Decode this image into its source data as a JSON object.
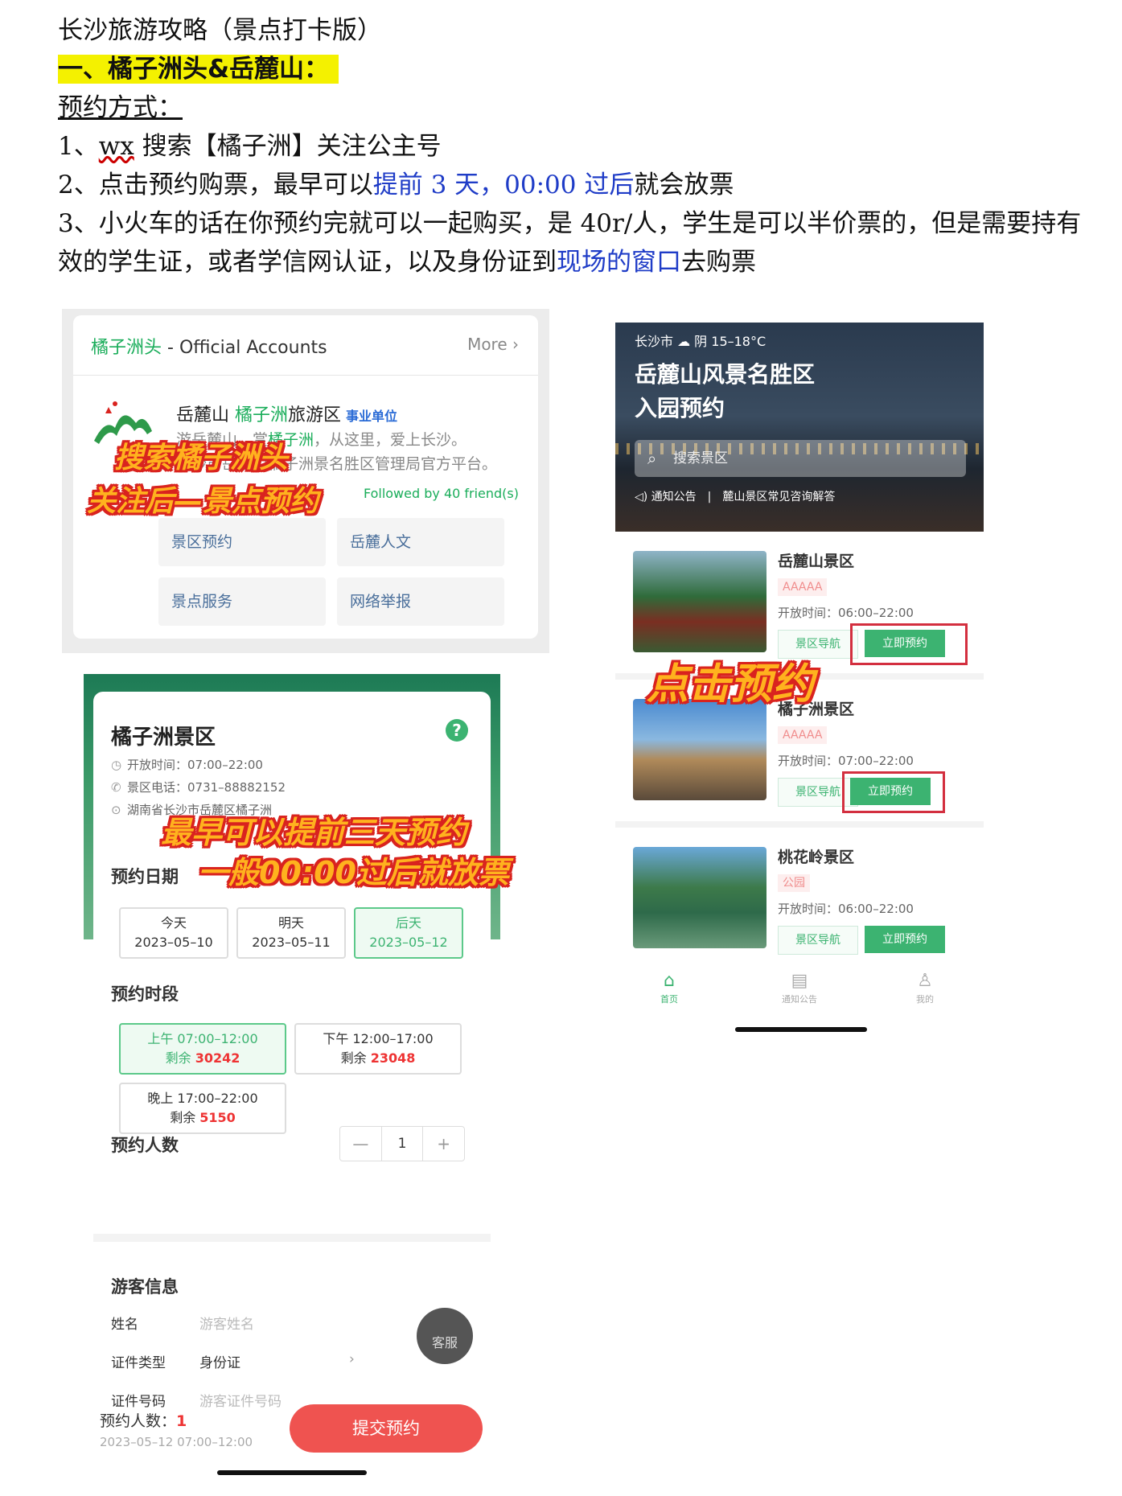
{
  "doc": {
    "title": "长沙旅游攻略（景点打卡版）",
    "section_title": "一、橘子洲头&岳麓山：",
    "method_label": "预约方式：",
    "step1_prefix": "1、",
    "step1_wx": "wx",
    "step1_rest": " 搜索【橘子洲】关注公主号",
    "step2_prefix": "2、点击预约购票，最早可以",
    "step2_blue": "提前 3 天，00:00 过后",
    "step2_suffix": "就会放票",
    "step3_a": "3、小火车的话在你预约完就可以一起购买，是 40r/人，学生是可以半价票的，但是需要持有效的学生证，或者学信网认证，以及身份证到",
    "step3_blue": "现场的窗口",
    "step3_b": "去购票"
  },
  "official_account": {
    "header_green": "橘子洲头",
    "header_rest": " - Official Accounts",
    "more": "More ›",
    "name_a": "岳麓山 ",
    "name_green": "橘子洲",
    "name_b": "旅游区",
    "tag": "事业单位",
    "desc_a": "游岳麓山，赏",
    "desc_green": "橘子洲",
    "desc_b": "，从这里，爱上长沙。",
    "desc_line2": "长沙市岳麓山橘子洲景名胜区管理局官方平台。",
    "followed": "Followed by 40 friend(s)",
    "buttons": [
      "景区预约",
      "岳麓人文",
      "景点服务",
      "网络举报"
    ]
  },
  "stickers": {
    "search_follow_1": "搜索橘子洲头",
    "search_follow_2": "关注后—景点预约",
    "click_book": "点击预约",
    "advance_1": "最早可以提前三天预约",
    "advance_2": "一般00:00过后就放票"
  },
  "booking": {
    "title": "橘子洲景区",
    "help_icon": "?",
    "open_time": "开放时间：07:00–22:00",
    "phone": "景区电话：0731–88882152",
    "address": "湖南省长沙市岳麓区橘子洲",
    "date_label": "预约日期",
    "dates": [
      {
        "day": "今天",
        "date": "2023–05–10"
      },
      {
        "day": "明天",
        "date": "2023–05–11"
      },
      {
        "day": "后天",
        "date": "2023–05–12"
      }
    ],
    "slot_label": "预约时段",
    "slots": [
      {
        "time": "上午 07:00–12:00",
        "remain_label": "剩余 ",
        "remain": "30242"
      },
      {
        "time": "下午 12:00–17:00",
        "remain_label": "剩余 ",
        "remain": "23048"
      },
      {
        "time": "晚上 17:00–22:00",
        "remain_label": "剩余 ",
        "remain": "5150"
      }
    ],
    "count_label": "预约人数",
    "count_minus": "—",
    "count_value": "1",
    "count_plus": "+",
    "visitor_title": "游客信息",
    "name_label": "姓名",
    "name_placeholder": "游客姓名",
    "idtype_label": "证件类型",
    "idtype_value": "身份证",
    "idtype_arrow": "›",
    "idno_label": "证件号码",
    "idno_placeholder": "游客证件号码",
    "service": "客服",
    "bottom_count_label": "预约人数：",
    "bottom_count_value": "1",
    "bottom_date": "2023–05–12 07:00–12:00",
    "submit": "提交预约"
  },
  "yuelu_app": {
    "weather": "长沙市 ☁ 阴 15–18°C",
    "title_1": "岳麓山风景名胜区",
    "title_2": "入园预约",
    "search_placeholder": "搜索景区",
    "notice_label": "通知公告",
    "notice_text": "麓山景区常见咨询解答",
    "spots": [
      {
        "name": "岳麓山景区",
        "tag": "AAAAA",
        "time": "开放时间：06:00–22:00",
        "nav": "景区导航",
        "book": "立即预约"
      },
      {
        "name": "橘子洲景区",
        "tag": "AAAAA",
        "time": "开放时间：07:00–22:00",
        "nav": "景区导航",
        "book": "立即预约"
      },
      {
        "name": "桃花岭景区",
        "tag": "公园",
        "time": "开放时间：06:00–22:00",
        "nav": "景区导航",
        "book": "立即预约"
      }
    ],
    "tabs": [
      {
        "label": "首页",
        "icon": "home-icon"
      },
      {
        "label": "通知公告",
        "icon": "notice-icon"
      },
      {
        "label": "我的",
        "icon": "user-icon"
      }
    ]
  },
  "colors": {
    "accent_green": "#3cb371",
    "submit_red": "#ef5350",
    "link_blue": "#1f3cc7",
    "highlight_yellow": "#f4f100"
  }
}
